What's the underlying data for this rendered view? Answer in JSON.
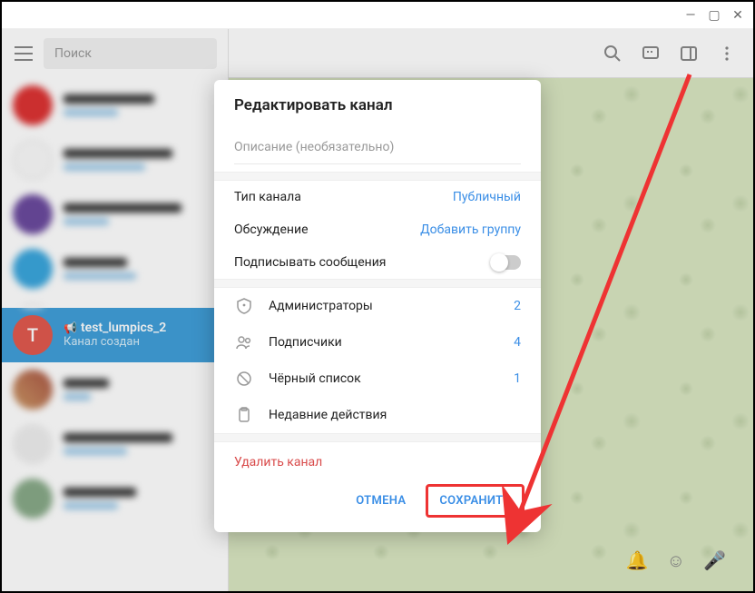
{
  "titlebar": {
    "minimize": "—",
    "maximize": "▢",
    "close": "✕"
  },
  "sidebar": {
    "search_placeholder": "Поиск",
    "active_chat": {
      "avatar_letter": "T",
      "name": "test_lumpics_2",
      "sub": "Канал создан"
    }
  },
  "modal": {
    "title": "Редактировать канал",
    "description_placeholder": "Описание (необязательно)",
    "rows": {
      "type_label": "Тип канала",
      "type_value": "Публичный",
      "discussion_label": "Обсуждение",
      "discussion_value": "Добавить группу",
      "sign_label": "Подписывать сообщения"
    },
    "mgmt": {
      "admins_label": "Администраторы",
      "admins_count": "2",
      "subs_label": "Подписчики",
      "subs_count": "4",
      "black_label": "Чёрный список",
      "black_count": "1",
      "recent_label": "Недавние действия"
    },
    "delete_label": "Удалить канал",
    "cancel_label": "Отмена",
    "save_label": "Сохранить"
  }
}
